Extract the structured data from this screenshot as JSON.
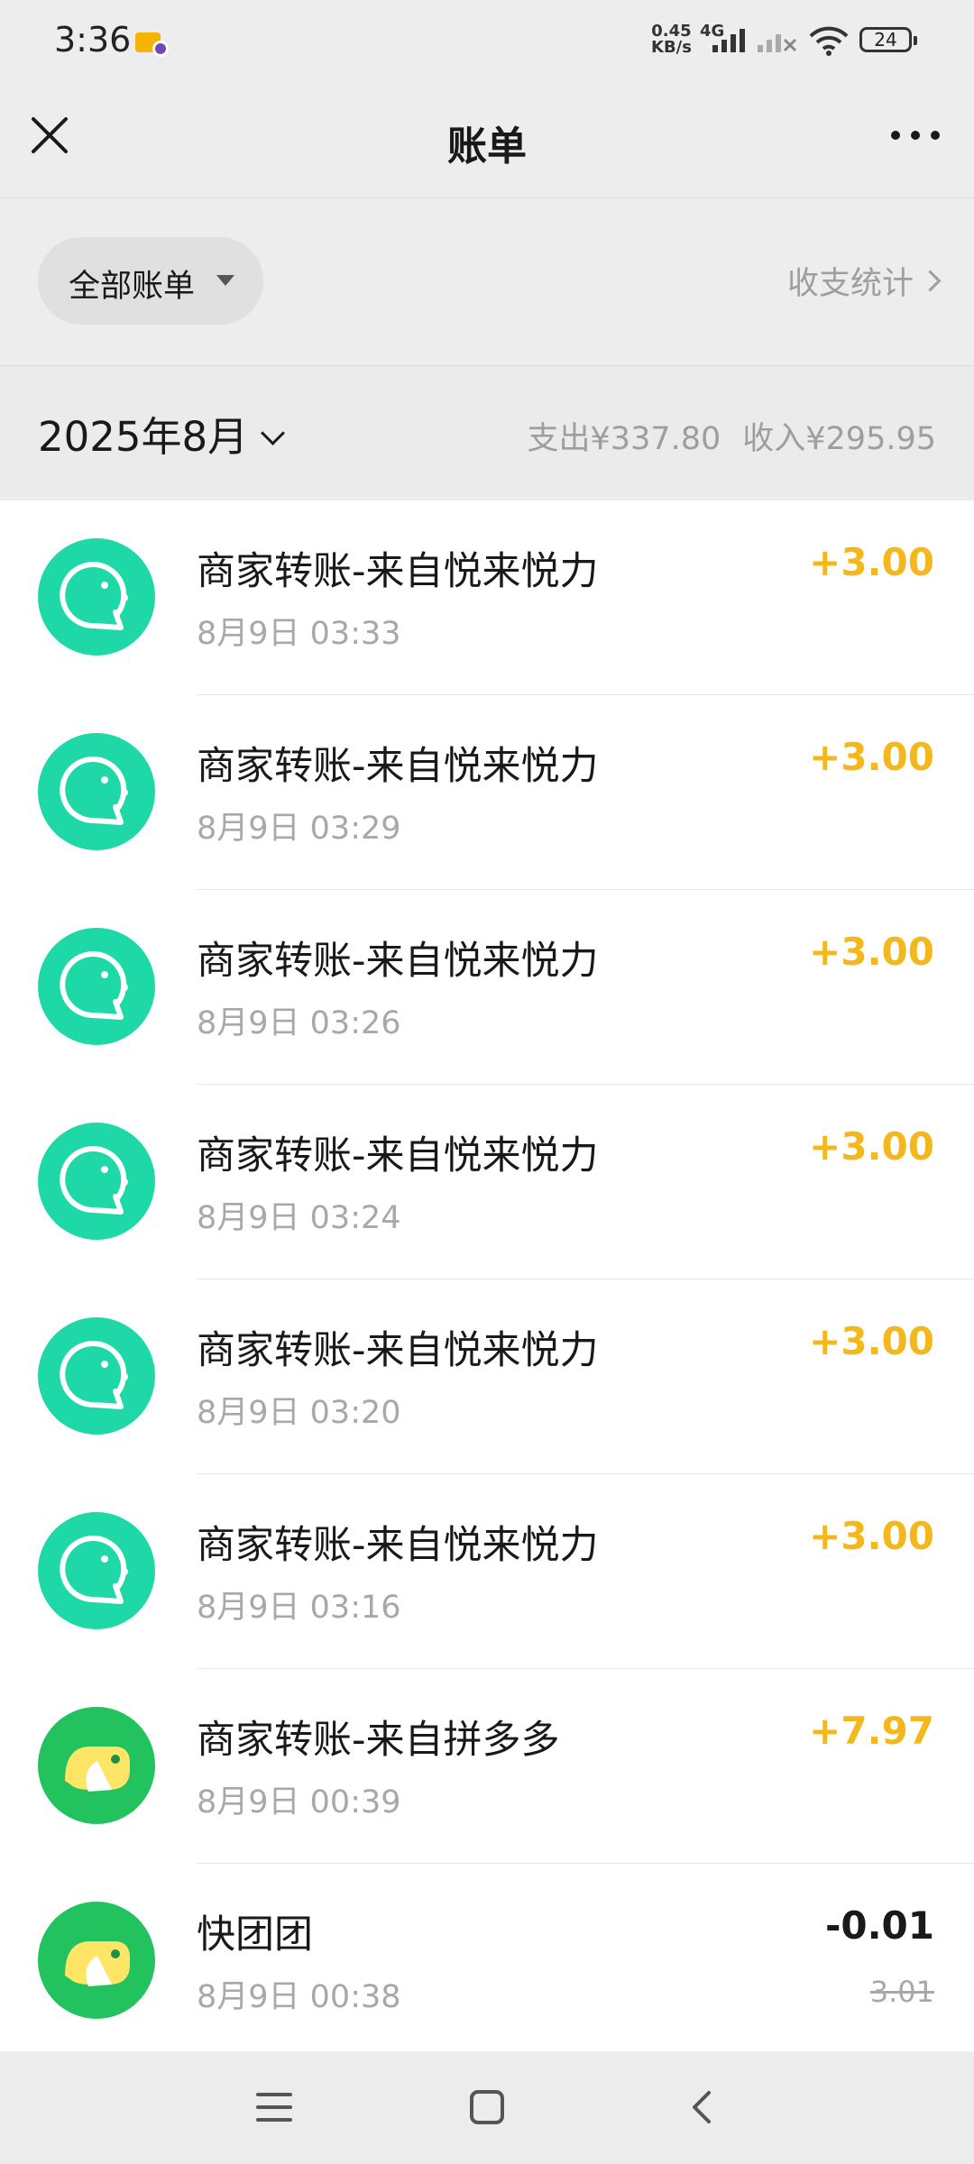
{
  "status_bar": {
    "time": "3:36",
    "net_speed_value": "0.45",
    "net_speed_unit": "KB/s",
    "network": "4G",
    "battery": "24",
    "icons": [
      "app-notification-icon",
      "signal-icon",
      "signal-no-sim-icon",
      "wifi-icon",
      "battery-icon"
    ]
  },
  "nav": {
    "title": "账单",
    "close_icon": "close-icon",
    "more_icon": "more-icon"
  },
  "filter": {
    "label": "全部账单",
    "stats_label": "收支统计"
  },
  "month": {
    "label": "2025年8月",
    "expense": "支出¥337.80",
    "income": "收入¥295.95"
  },
  "transactions": [
    {
      "title": "商家转账-来自悦来悦力",
      "time": "8月9日 03:33",
      "amount": "+3.00",
      "icon": "wechat-merchant-icon"
    },
    {
      "title": "商家转账-来自悦来悦力",
      "time": "8月9日 03:29",
      "amount": "+3.00",
      "icon": "wechat-merchant-icon"
    },
    {
      "title": "商家转账-来自悦来悦力",
      "time": "8月9日 03:26",
      "amount": "+3.00",
      "icon": "wechat-merchant-icon"
    },
    {
      "title": "商家转账-来自悦来悦力",
      "time": "8月9日 03:24",
      "amount": "+3.00",
      "icon": "wechat-merchant-icon"
    },
    {
      "title": "商家转账-来自悦来悦力",
      "time": "8月9日 03:20",
      "amount": "+3.00",
      "icon": "wechat-merchant-icon"
    },
    {
      "title": "商家转账-来自悦来悦力",
      "time": "8月9日 03:16",
      "amount": "+3.00",
      "icon": "wechat-merchant-icon"
    },
    {
      "title": "商家转账-来自拼多多",
      "time": "8月9日 00:39",
      "amount": "+7.97",
      "icon": "pinduoduo-icon"
    },
    {
      "title": "快团团",
      "time": "8月9日 00:38",
      "amount": "-0.01",
      "original_amount": "3.01",
      "icon": "kuaituantuan-icon"
    }
  ],
  "colors": {
    "income": "#f4b81d",
    "expense": "#191919",
    "wechat_green": "#1ed8a8",
    "pdd_green": "#22c35e"
  },
  "system_nav": {
    "icons": [
      "menu-icon",
      "home-icon",
      "back-icon"
    ]
  }
}
